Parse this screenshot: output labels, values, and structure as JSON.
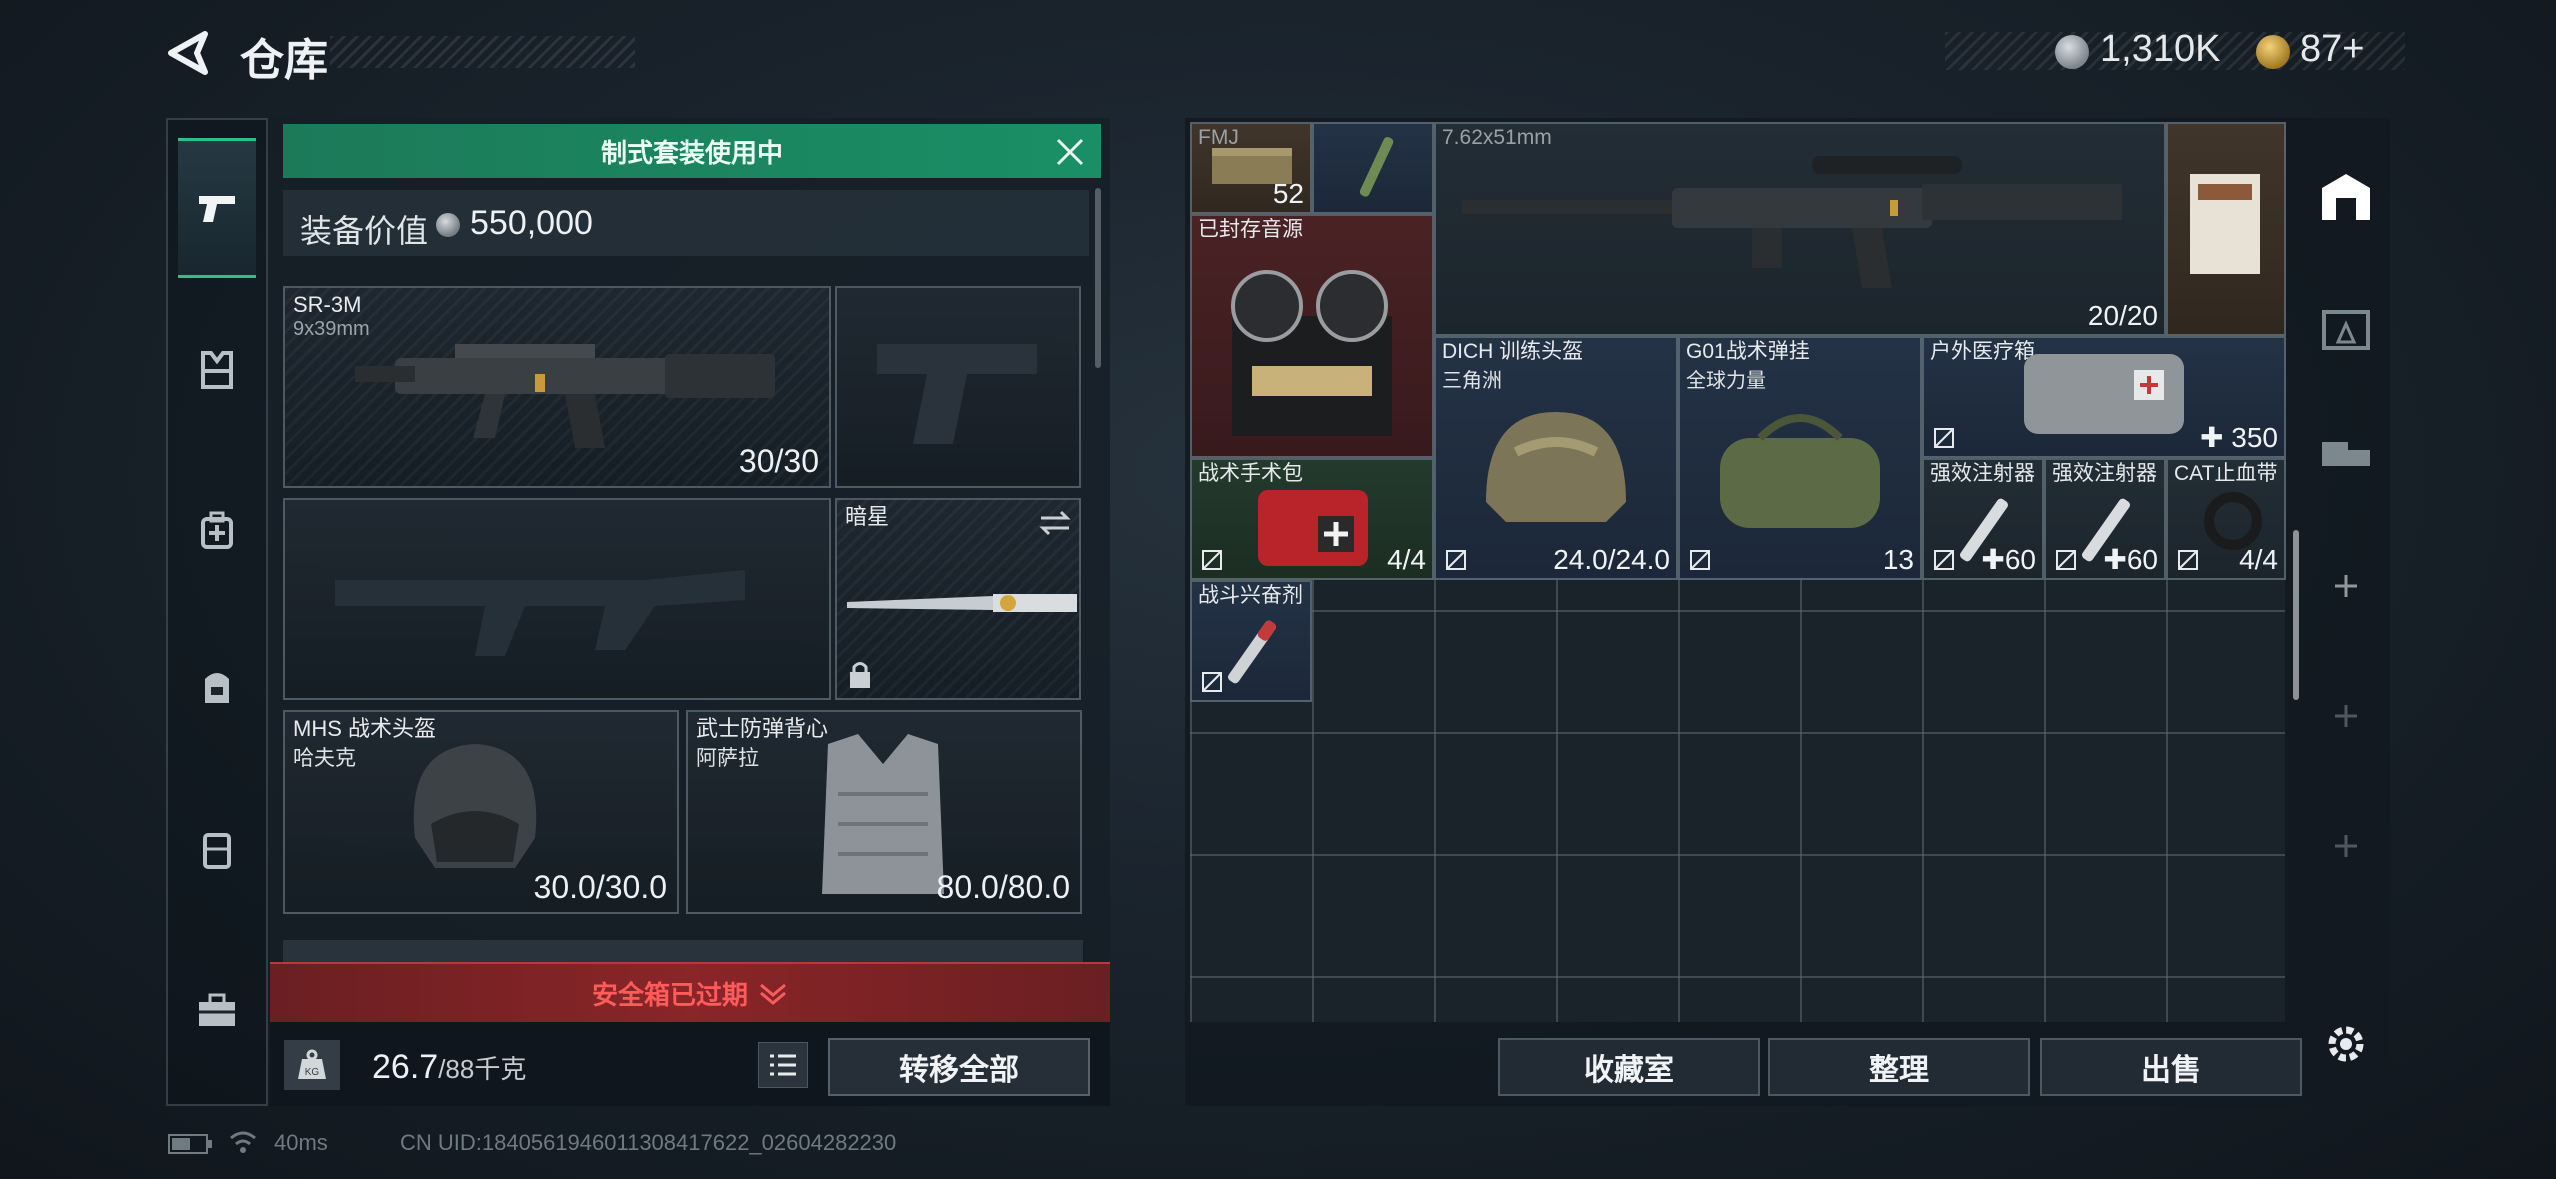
{
  "header": {
    "title": "仓库",
    "currency_silver": "1,310K",
    "currency_gold": "87+"
  },
  "equipment": {
    "banner": "制式套装使用中",
    "value_label": "装备价值",
    "value": "550,000",
    "primary": {
      "name": "SR-3M",
      "ammo": "9x39mm",
      "count": "30/30"
    },
    "melee": {
      "name": "暗星"
    },
    "helmet": {
      "name": "MHS 战术头盔",
      "sub": "哈夫克",
      "durability": "30.0/30.0"
    },
    "armor": {
      "name": "武士防弹背心",
      "sub": "阿萨拉",
      "durability": "80.0/80.0"
    },
    "safebox_status": "安全箱已过期",
    "weight_current": "26.7",
    "weight_max": "/88千克",
    "kg_label": "KG",
    "transfer_all": "转移全部"
  },
  "storage": {
    "items": [
      {
        "label": "FMJ",
        "count": "52",
        "color": "brown"
      },
      {
        "label": "",
        "count": "",
        "color": "blue"
      },
      {
        "label": "7.62x51mm",
        "count": "20/20",
        "color": "dark"
      },
      {
        "label": "",
        "count": "",
        "color": "brown"
      },
      {
        "label": "已封存音源",
        "count": "",
        "color": "red"
      },
      {
        "label": "DICH 训练头盔",
        "sub": "三角洲",
        "count": "24.0/24.0",
        "color": "blue"
      },
      {
        "label": "G01战术弹挂",
        "sub": "全球力量",
        "count": "13",
        "color": "blue"
      },
      {
        "label": "户外医疗箱",
        "count": "350",
        "color": "blue"
      },
      {
        "label": "战术手术包",
        "count": "4/4",
        "color": "green"
      },
      {
        "label": "强效注射器",
        "count": "60",
        "color": "dark"
      },
      {
        "label": "强效注射器",
        "count": "60",
        "color": "dark"
      },
      {
        "label": "CAT止血带",
        "count": "4/4",
        "color": "dark"
      },
      {
        "label": "战斗兴奋剂",
        "count": "",
        "color": "blue"
      }
    ],
    "collection_btn": "收藏室",
    "sort_btn": "整理",
    "sell_btn": "出售"
  },
  "status_bar": {
    "ping": "40ms",
    "uid": "CN UID:1840561946011308417622_02604282230"
  },
  "colors": {
    "accent_green": "#1c7a59",
    "warning_red": "#ff5b5b"
  }
}
